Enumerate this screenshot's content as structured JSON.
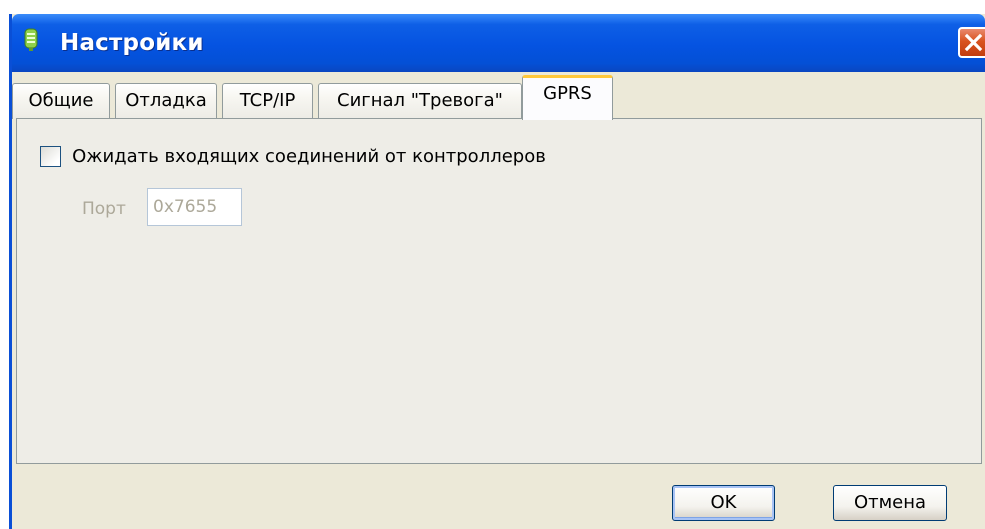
{
  "window": {
    "title": "Настройки",
    "icon": "app-icon",
    "close_icon": "close-icon"
  },
  "tabs": [
    {
      "label": "Общие",
      "active": false
    },
    {
      "label": "Отладка",
      "active": false
    },
    {
      "label": "TCP/IP",
      "active": false
    },
    {
      "label": "Сигнал \"Тревога\"",
      "active": false
    },
    {
      "label": "GPRS",
      "active": true
    }
  ],
  "gprs": {
    "wait_incoming_label": "Ожидать входящих соединений от контроллеров",
    "wait_incoming_checked": false,
    "port_label": "Порт",
    "port_value": "0x7655",
    "port_enabled": false
  },
  "buttons": {
    "ok_label": "OK",
    "cancel_label": "Отмена"
  },
  "colors": {
    "titlebar": "#0553e1",
    "close_button": "#d9531f",
    "active_tab_highlight": "#ffc83c",
    "dialog_background": "#ece9d8"
  }
}
